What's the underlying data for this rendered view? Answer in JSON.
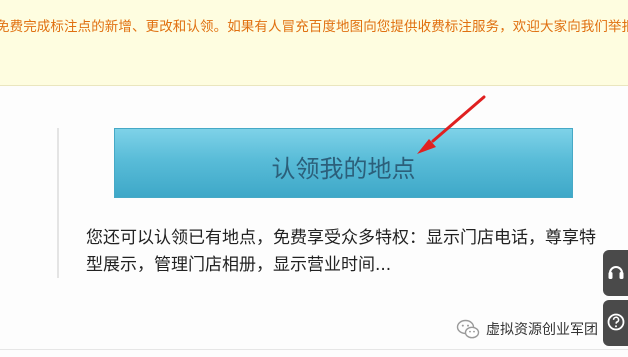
{
  "notice": {
    "text": "免费完成标注点的新增、更改和认领。如果有人冒充百度地图向您提供收费标注服务，欢迎大家向我们举报。"
  },
  "claim_button": {
    "label": "认领我的地点"
  },
  "description": {
    "text": "您还可以认领已有地点，免费享受众多特权：显示门店电话，尊享特型展示，管理门店相册，显示营业时间..."
  },
  "watermark": {
    "text": "虚拟资源创业军团",
    "icon": "wechat-icon"
  },
  "colors": {
    "notice_bg": "#fefde0",
    "notice_text": "#e07010",
    "button_top": "#7ed2e8",
    "button_bottom": "#3ea8c8",
    "button_text": "#2c5f7a",
    "annotation_arrow": "#e02020"
  }
}
